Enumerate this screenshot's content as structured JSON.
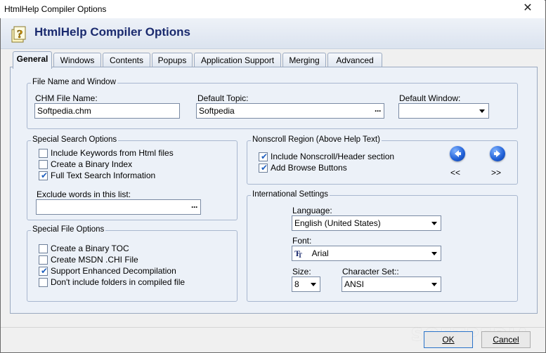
{
  "window": {
    "title": "HtmlHelp Compiler Options",
    "close_glyph": "✕"
  },
  "header": {
    "title": "HtmlHelp Compiler Options",
    "icon": "help-question-icon"
  },
  "tabs": [
    {
      "label": "General",
      "active": true
    },
    {
      "label": "Windows",
      "active": false
    },
    {
      "label": "Contents",
      "active": false
    },
    {
      "label": "Popups",
      "active": false
    },
    {
      "label": "Application Support",
      "active": false
    },
    {
      "label": "Merging",
      "active": false
    },
    {
      "label": "Advanced",
      "active": false
    }
  ],
  "file_name_window": {
    "legend": "File Name and Window",
    "chm_label": "CHM File Name:",
    "chm_value": "Softpedia.chm",
    "topic_label": "Default Topic:",
    "topic_value": "Softpedia",
    "topic_button": "···",
    "window_label": "Default Window:",
    "window_value": ""
  },
  "search_options": {
    "legend": "Special Search Options",
    "items": [
      {
        "label": "Include Keywords from Html files",
        "checked": false
      },
      {
        "label": "Create a Binary Index",
        "checked": false
      },
      {
        "label": "Full Text Search Information",
        "checked": true
      }
    ],
    "exclude_label": "Exclude words in this list:",
    "exclude_value": "",
    "exclude_button": "···"
  },
  "file_options": {
    "legend": "Special File Options",
    "items": [
      {
        "label": "Create a Binary TOC",
        "checked": false
      },
      {
        "label": "Create MSDN .CHI File",
        "checked": false
      },
      {
        "label": "Support Enhanced Decompilation",
        "checked": true
      },
      {
        "label": "Don't include folders in compiled file",
        "checked": false
      }
    ]
  },
  "nonscroll": {
    "legend": "Nonscroll Region (Above Help Text)",
    "items": [
      {
        "label": "Include Nonscroll/Header section",
        "checked": true
      },
      {
        "label": "Add Browse Buttons",
        "checked": true
      }
    ],
    "prev_label": "<<",
    "next_label": ">>"
  },
  "international": {
    "legend": "International Settings",
    "language_label": "Language:",
    "language_value": "English (United States)",
    "font_label": "Font:",
    "font_value": "Arial",
    "size_label": "Size:",
    "size_value": "8",
    "charset_label": "Character Set::",
    "charset_value": "ANSI"
  },
  "footer": {
    "ok_label": "OK",
    "cancel_label": "Cancel",
    "watermark": "SOFTPEDIA"
  },
  "colors": {
    "title_text": "#1a2a6e",
    "panel_bg": "#ecf1f8",
    "accent_blue": "#1f5fd6"
  }
}
